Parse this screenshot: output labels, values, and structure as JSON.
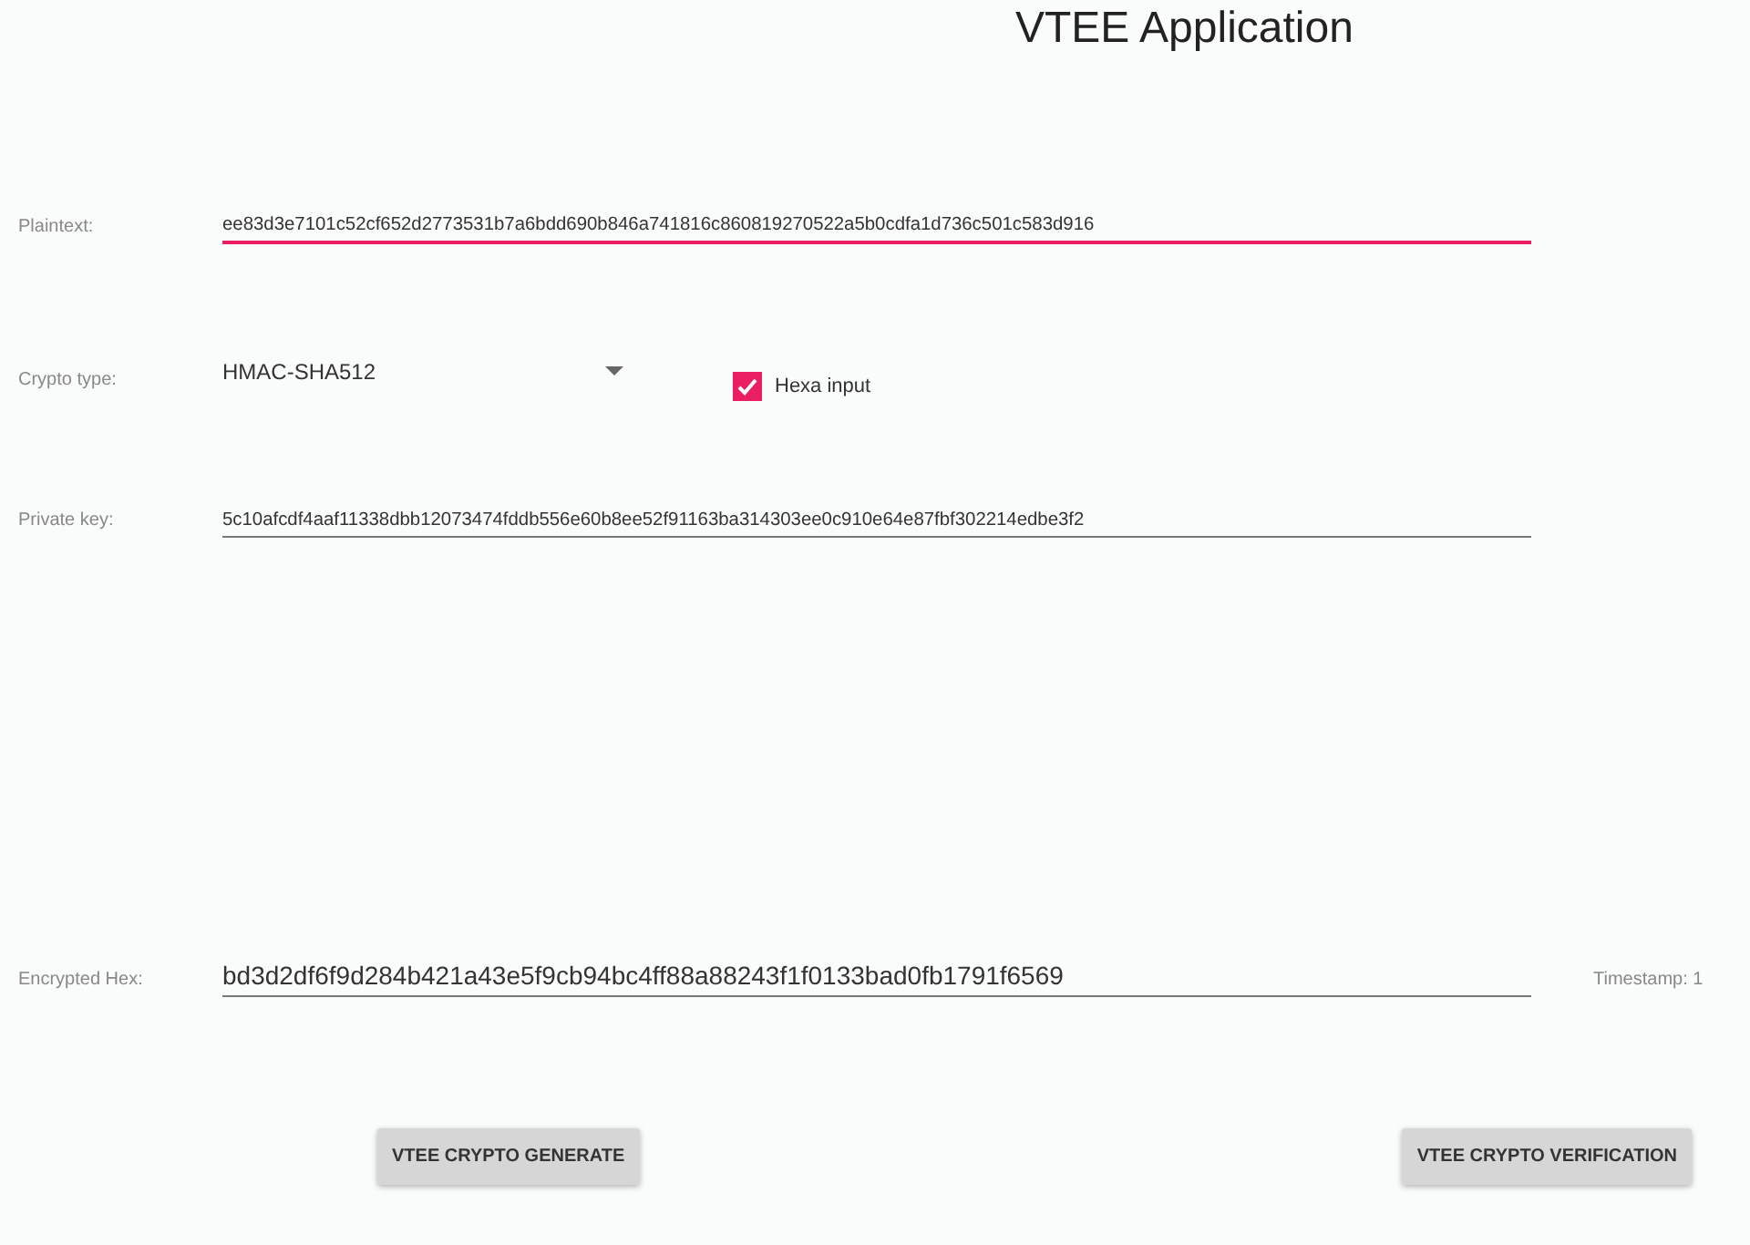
{
  "title": "VTEE Application",
  "fields": [
    {
      "kind": "text",
      "label": "Plaintext:",
      "value": "ee83d3e7101c52cf652d2773531b7a6bdd690b846a741816c860819270522a5b0cdfa1d736c501c583d916",
      "focused": true
    },
    {
      "kind": "select",
      "label": "Crypto type:",
      "value": "HMAC-SHA512",
      "checkbox": {
        "label": "Hexa input",
        "checked": true
      }
    },
    {
      "kind": "text",
      "label": "Private key:",
      "value": "5c10afcdf4aaf11338dbb12073474fddb556e60b8ee52f91163ba314303ee0c910e64e87fbf302214edbe3f2",
      "focused": false
    },
    {
      "kind": "output",
      "label": "Encrypted Hex:",
      "value": "bd3d2df6f9d284b421a43e5f9cb94bc4ff88a88243f1f0133bad0fb1791f6569",
      "focused": false,
      "side_text": "Timestamp: 1"
    }
  ],
  "buttons": [
    "VTEE CRYPTO GENERATE",
    "VTEE CRYPTO VERIFICATION"
  ]
}
